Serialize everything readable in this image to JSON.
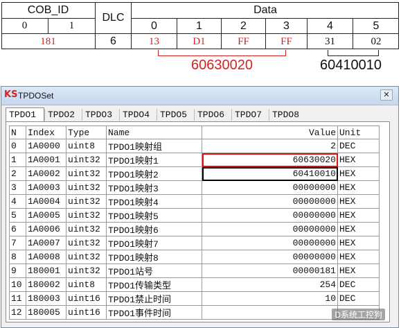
{
  "frame": {
    "headers": {
      "cob_id": "COB_ID",
      "dlc": "DLC",
      "data": "Data"
    },
    "cob_sub": [
      "0",
      "1"
    ],
    "data_idx": [
      "0",
      "1",
      "2",
      "3",
      "4",
      "5"
    ],
    "cob_value": "181",
    "dlc_value": "6",
    "data_bytes": [
      "13",
      "D1",
      "FF",
      "FF",
      "31",
      "02"
    ],
    "group_red_label": "60630020",
    "group_black_label": "60410010",
    "colors": {
      "red": "#d42121",
      "black": "#111111"
    }
  },
  "window": {
    "logo": "KS",
    "title": "TPDOSet",
    "close_glyph": "✕",
    "tabs": [
      "TPDO1",
      "TPDO2",
      "TPDO3",
      "TPDO4",
      "TPDO5",
      "TPDO6",
      "TPDO7",
      "TPDO8"
    ],
    "active_tab": "TPDO1",
    "columns": [
      "N",
      "Index",
      "Type",
      "Name",
      "Value",
      "Unit"
    ],
    "rows": [
      [
        "0",
        "1A0000",
        "uint8",
        "TPDO1映射组",
        "2",
        "DEC"
      ],
      [
        "1",
        "1A0001",
        "uint32",
        "TPDO1映射1",
        "60630020",
        "HEX"
      ],
      [
        "2",
        "1A0002",
        "uint32",
        "TPDO1映射2",
        "60410010",
        "HEX"
      ],
      [
        "3",
        "1A0003",
        "uint32",
        "TPDO1映射3",
        "00000000",
        "HEX"
      ],
      [
        "4",
        "1A0004",
        "uint32",
        "TPDO1映射4",
        "00000000",
        "HEX"
      ],
      [
        "5",
        "1A0005",
        "uint32",
        "TPDO1映射5",
        "00000000",
        "HEX"
      ],
      [
        "6",
        "1A0006",
        "uint32",
        "TPDO1映射6",
        "00000000",
        "HEX"
      ],
      [
        "7",
        "1A0007",
        "uint32",
        "TPDO1映射7",
        "00000000",
        "HEX"
      ],
      [
        "8",
        "1A0008",
        "uint32",
        "TPDO1映射8",
        "00000000",
        "HEX"
      ],
      [
        "9",
        "180001",
        "uint32",
        "TPDO1站号",
        "00000181",
        "HEX"
      ],
      [
        "10",
        "180002",
        "uint8",
        "TPDO1传输类型",
        "254",
        "DEC"
      ],
      [
        "11",
        "180003",
        "uint16",
        "TPDO1禁止时间",
        "10",
        "DEC"
      ],
      [
        "12",
        "180005",
        "uint16",
        "TPDO1事件时间",
        "",
        ""
      ]
    ],
    "highlight": {
      "red_row": 1,
      "black_row": 2
    },
    "watermark": "D系统工控狗"
  }
}
